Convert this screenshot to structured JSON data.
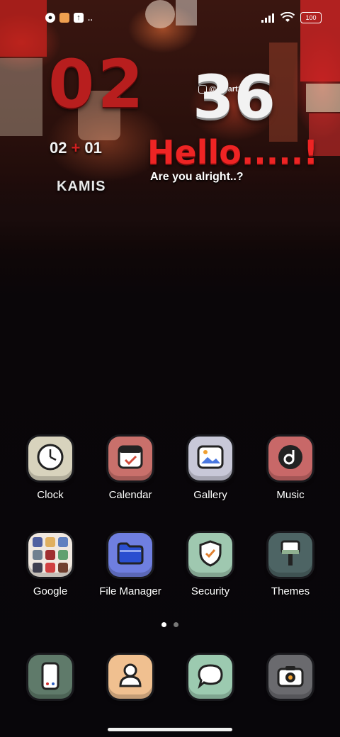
{
  "status_bar": {
    "battery": "100",
    "left_icons": [
      "notification-icon",
      "app-icon",
      "upload-icon",
      "more-dots-icon"
    ],
    "right_icons": [
      "signal-icon",
      "wifi-icon",
      "battery-icon"
    ]
  },
  "widget": {
    "handle": "@lanart18",
    "hour": "02",
    "minute": "36",
    "date_day": "02",
    "date_sep": "+",
    "date_month": "01",
    "day_name": "KAMIS",
    "greeting": "Hello.....!",
    "subtitle": "Are you alright..?"
  },
  "apps_row1": [
    {
      "label": "Clock",
      "icon": "clock-icon",
      "color": "#d8d3bd"
    },
    {
      "label": "Calendar",
      "icon": "calendar-icon",
      "color": "#c9706b"
    },
    {
      "label": "Gallery",
      "icon": "gallery-icon",
      "color": "#c8c8d8"
    },
    {
      "label": "Music",
      "icon": "music-icon",
      "color": "#c86868"
    }
  ],
  "apps_row2": [
    {
      "label": "Google",
      "icon": "folder-icon",
      "color": "#f0e8e0"
    },
    {
      "label": "File Manager",
      "icon": "file-manager-icon",
      "color": "#6f7fe0"
    },
    {
      "label": "Security",
      "icon": "security-icon",
      "color": "#9fc8b0"
    },
    {
      "label": "Themes",
      "icon": "themes-icon",
      "color": "#4d6464"
    }
  ],
  "dock": [
    {
      "icon": "phone-icon",
      "color": "#5f7a6a"
    },
    {
      "icon": "contacts-icon",
      "color": "#f0c090"
    },
    {
      "icon": "messages-icon",
      "color": "#9ccab0"
    },
    {
      "icon": "camera-icon",
      "color": "#6a6a6e"
    }
  ],
  "pages": {
    "count": 2,
    "active": 1
  }
}
